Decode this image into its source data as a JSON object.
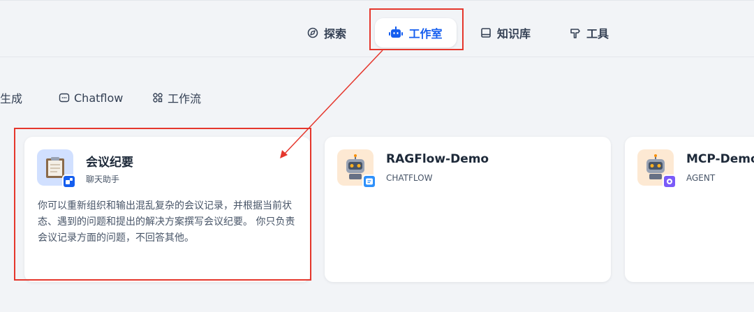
{
  "nav": {
    "explore": "探索",
    "studio": "工作室",
    "knowledge": "知识库",
    "tools": "工具"
  },
  "filters": {
    "generation": "生成",
    "chatflow": "Chatflow",
    "workflow": "工作流"
  },
  "apps": [
    {
      "title": "会议纪要",
      "type": "聊天助手",
      "description": "你可以重新组织和输出混乱复杂的会议记录，并根据当前状态、遇到的问题和提出的解决方案撰写会议纪要。 你只负责会议记录方面的问题，不回答其他。"
    },
    {
      "title": "RAGFlow-Demo",
      "type": "CHATFLOW",
      "description": ""
    },
    {
      "title": "MCP-Demo",
      "type": "AGENT",
      "description": ""
    }
  ],
  "colors": {
    "accent": "#155eef",
    "annotation": "#e5362c"
  }
}
